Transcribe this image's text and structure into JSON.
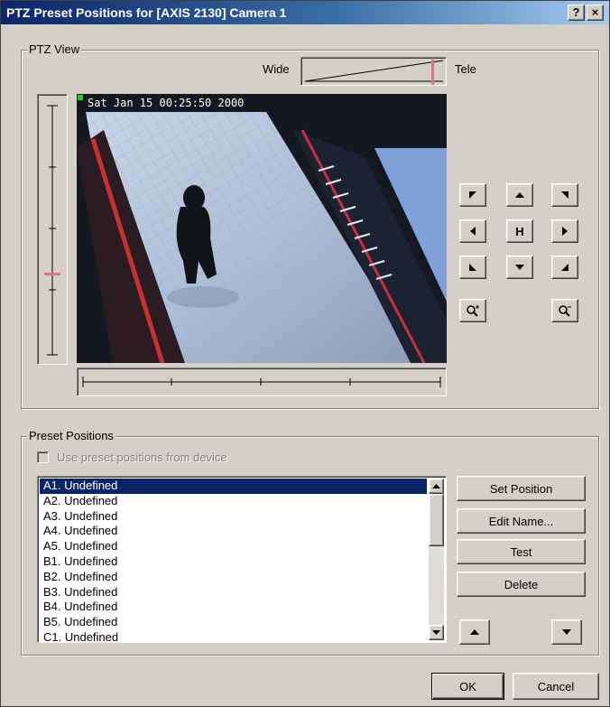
{
  "window": {
    "title": "PTZ Preset Positions for [AXIS 2130] Camera 1",
    "help_glyph": "?",
    "close_glyph": "×"
  },
  "ptz_view": {
    "group_label": "PTZ View",
    "zoom_wide_label": "Wide",
    "zoom_tele_label": "Tele",
    "zoom_level_fraction": 0.93,
    "tilt_level_fraction": 0.67,
    "camera_timestamp": "Sat Jan 15  00:25:50  2000",
    "home_label": "H",
    "controls": [
      {
        "name": "pan-up-left-button",
        "icon": "arrow-up-left-icon"
      },
      {
        "name": "tilt-up-button",
        "icon": "arrow-up-icon"
      },
      {
        "name": "pan-up-right-button",
        "icon": "arrow-up-right-icon"
      },
      {
        "name": "pan-left-button",
        "icon": "arrow-left-icon"
      },
      {
        "name": "home-button",
        "icon": "home-icon"
      },
      {
        "name": "pan-right-button",
        "icon": "arrow-right-icon"
      },
      {
        "name": "pan-down-left-button",
        "icon": "arrow-down-left-icon"
      },
      {
        "name": "tilt-down-button",
        "icon": "arrow-down-icon"
      },
      {
        "name": "pan-down-right-button",
        "icon": "arrow-down-right-icon"
      }
    ],
    "zoom_in_icon": "zoom-in-icon",
    "zoom_out_icon": "zoom-out-icon"
  },
  "presets": {
    "group_label": "Preset Positions",
    "use_device_label": "Use preset positions from device",
    "use_device_checked": false,
    "use_device_enabled": false,
    "items": [
      "A1. Undefined",
      "A2. Undefined",
      "A3. Undefined",
      "A4. Undefined",
      "A5. Undefined",
      "B1. Undefined",
      "B2. Undefined",
      "B3. Undefined",
      "B4. Undefined",
      "B5. Undefined",
      "C1. Undefined"
    ],
    "selected_index": 0,
    "set_position_label": "Set Position",
    "edit_name_label": "Edit Name...",
    "test_label": "Test",
    "delete_label": "Delete"
  },
  "footer": {
    "ok_label": "OK",
    "cancel_label": "Cancel"
  },
  "colors": {
    "titlebar_start": "#0a246a",
    "selection": "#0a246a",
    "indicator_pink": "#e8708a",
    "dialog_face": "#d4d0c8"
  }
}
